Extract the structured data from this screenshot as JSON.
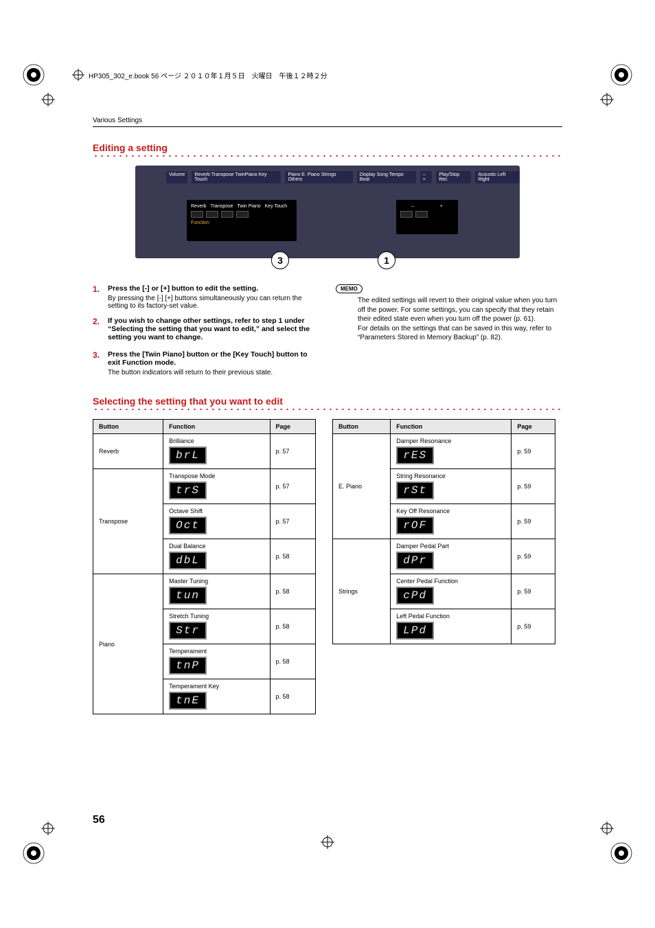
{
  "header_crop_text": "HP305_302_e.book  56 ページ  ２０１０年１月５日　火曜日　午後１２時２分",
  "running_header": "Various Settings",
  "section1_heading": "Editing a setting",
  "panel": {
    "zoom_left_labels": [
      "Reverb",
      "Transpose",
      "Twin Piano",
      "Key Touch"
    ],
    "zoom_left_function": "Function",
    "zoom_right_minus": "–",
    "zoom_right_plus": "+",
    "top_strip": [
      "Volume",
      "Reverb  Transpose TwinPiano Key Touch",
      "Piano   E. Piano  Strings  Others",
      "Display    Song  Tempo  Beat",
      "–   +",
      "Play/Stop  Rec",
      "Acoustic  Left  Right"
    ]
  },
  "callouts": {
    "c3": "3",
    "c1": "1"
  },
  "steps": [
    {
      "num": "1.",
      "head": "Press the [-] or [+] button to edit the setting.",
      "body": "By pressing the [-] [+] buttons simultaneously you can return the setting to its factory-set value."
    },
    {
      "num": "2.",
      "head": "If you wish to change other settings, refer to step 1 under “Selecting the setting that you want to edit,” and select the setting you want to change.",
      "body": ""
    },
    {
      "num": "3.",
      "head": "Press the [Twin Piano] button or the [Key Touch] button to exit Function mode.",
      "body": "The button indicators will return to their previous state."
    }
  ],
  "memo": {
    "badge": "MEMO",
    "text1": "The edited settings will revert to their original value when you turn off the power. For some settings, you can specify that they retain their edited state even when you turn off the power (p. 61).",
    "text2": "For details on the settings that can be saved in this way, refer to  “Parameters Stored in Memory Backup” (p. 82)."
  },
  "section2_heading": "Selecting the setting that you want to edit",
  "table_headers": {
    "button": "Button",
    "function": "Function",
    "page": "Page"
  },
  "table_left": [
    {
      "button": "Reverb",
      "rows": [
        {
          "func": "Brilliance",
          "code": "brL",
          "page": "p. 57"
        }
      ]
    },
    {
      "button": "Transpose",
      "rows": [
        {
          "func": "Transpose Mode",
          "code": "trS",
          "page": "p. 57"
        },
        {
          "func": "Octave Shift",
          "code": "Oct",
          "page": "p. 57"
        },
        {
          "func": "Dual Balance",
          "code": "dbL",
          "page": "p. 58"
        }
      ]
    },
    {
      "button": "Piano",
      "rows": [
        {
          "func": "Master Tuning",
          "code": "tun",
          "page": "p. 58"
        },
        {
          "func": "Stretch Tuning",
          "code": "Str",
          "page": "p. 58"
        },
        {
          "func": "Temperament",
          "code": "tnP",
          "page": "p. 58"
        },
        {
          "func": "Temperament Key",
          "code": "tnE",
          "page": "p. 58"
        }
      ]
    }
  ],
  "table_right": [
    {
      "button": "E. Piano",
      "rows": [
        {
          "func": "Damper Resonance",
          "code": "rES",
          "page": "p. 59"
        },
        {
          "func": "String Resonance",
          "code": "rSt",
          "page": "p. 59"
        },
        {
          "func": "Key Off Resonance",
          "code": "rOF",
          "page": "p. 59"
        }
      ]
    },
    {
      "button": "Strings",
      "rows": [
        {
          "func": "Damper Pedal Part",
          "code": "dPr",
          "page": "p. 59"
        },
        {
          "func": "Center Pedal Function",
          "code": "cPd",
          "page": "p. 59"
        },
        {
          "func": "Left Pedal Function",
          "code": "LPd",
          "page": "p. 59"
        }
      ]
    }
  ],
  "page_number": "56"
}
